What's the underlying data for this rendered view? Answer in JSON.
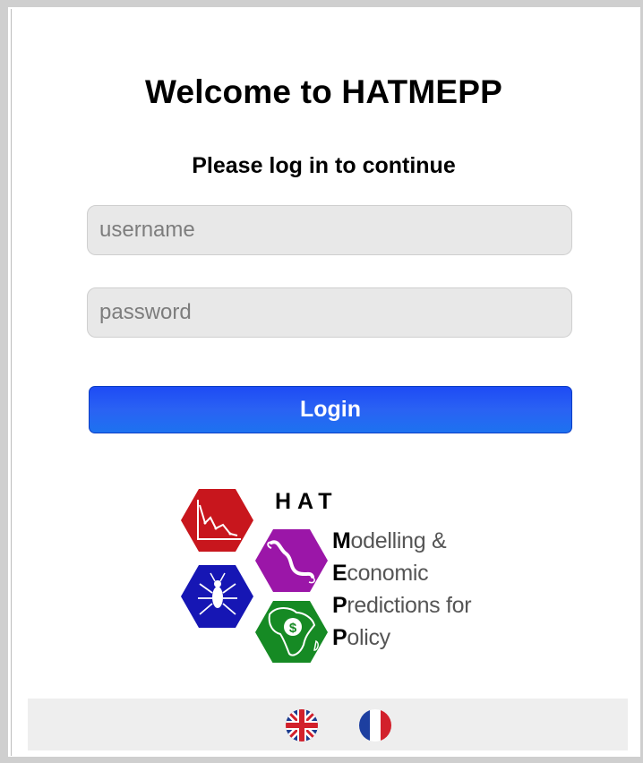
{
  "header": {
    "title": "Welcome to HATMEPP",
    "subtitle": "Please log in to continue"
  },
  "form": {
    "username_placeholder": "username",
    "username_value": "",
    "password_placeholder": "password",
    "password_value": "",
    "login_label": "Login"
  },
  "logo": {
    "hat": "HAT",
    "lines": [
      {
        "cap": "M",
        "rest": "odelling &"
      },
      {
        "cap": "E",
        "rest": "conomic"
      },
      {
        "cap": "P",
        "rest": "redictions for"
      },
      {
        "cap": "P",
        "rest": "olicy"
      }
    ],
    "hex_colors": {
      "chart": "#c8161d",
      "parasite": "#9b16a8",
      "insect": "#1616b4",
      "africa": "#168a24"
    }
  },
  "footer": {
    "languages": [
      {
        "code": "en",
        "icon": "uk-flag-icon"
      },
      {
        "code": "fr",
        "icon": "france-flag-icon"
      }
    ]
  },
  "colors": {
    "login_button": "#2a62f3",
    "input_bg": "#e8e8e8",
    "footer_bg": "#eeeeee"
  }
}
